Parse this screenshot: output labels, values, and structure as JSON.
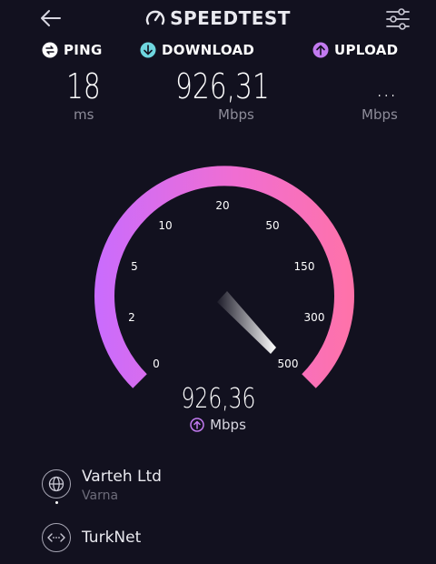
{
  "header": {
    "brand": "SPEEDTEST",
    "back_icon": "arrow-left-icon",
    "menu_icon": "sliders-icon"
  },
  "metrics": {
    "ping": {
      "label": "PING",
      "value": "18",
      "unit": "ms",
      "icon": "ping-icon"
    },
    "download": {
      "label": "DOWNLOAD",
      "value": "926,31",
      "unit": "Mbps",
      "icon": "download-icon"
    },
    "upload": {
      "label": "UPLOAD",
      "value": "...",
      "unit": "Mbps",
      "icon": "upload-icon"
    }
  },
  "gauge": {
    "scale": [
      "0",
      "2",
      "5",
      "10",
      "20",
      "50",
      "150",
      "300",
      "500"
    ],
    "current_value": "926,36",
    "unit": "Mbps",
    "colors": {
      "start": "#cc6eff",
      "end": "#ff72a8"
    }
  },
  "server": {
    "provider": "Varteh Ltd",
    "location": "Varna",
    "isp": "TurkNet",
    "provider_icon": "globe-icon",
    "isp_icon": "connection-icon"
  }
}
